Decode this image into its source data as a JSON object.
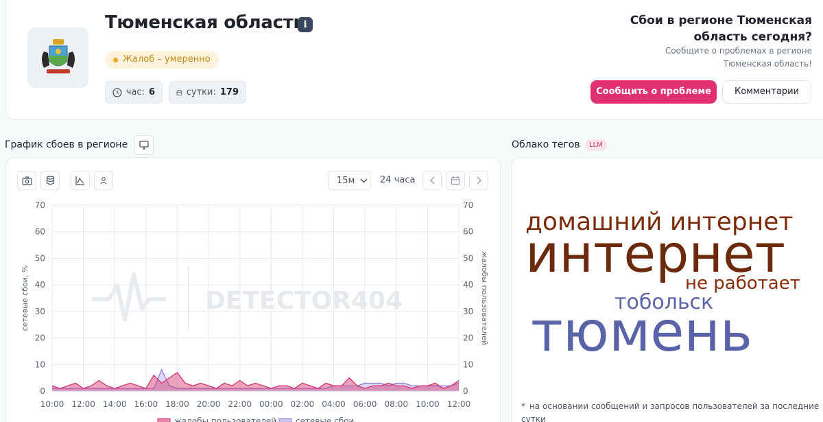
{
  "header": {
    "region_title": "Тюменская область",
    "status_badge": "Жалоб – умеренно",
    "stats": [
      {
        "label": "час:",
        "value": "6"
      },
      {
        "label": "сутки:",
        "value": "179"
      }
    ],
    "question_title": "Сбои в регионе Тюменская область сегодня?",
    "question_sub": "Сообщите о проблемах в регионе Тюменская область!",
    "report_button": "Сообщить о проблеме",
    "comments_button": "Комментарии"
  },
  "chart_section": {
    "title": "График сбоев в регионе",
    "interval_select": "15м",
    "period_label": "24 часа",
    "watermark": "DETECTOR404"
  },
  "cloud_section": {
    "title": "Облако тегов",
    "llm_badge": "LLM",
    "words": [
      {
        "text": "домашний интернет",
        "color": "#7b2b0a"
      },
      {
        "text": "интернет",
        "color": "#6b2a0c"
      },
      {
        "text": "не работает",
        "color": "#8a2e0e"
      },
      {
        "text": "тобольск",
        "color": "#5a63a8"
      },
      {
        "text": "тюмень",
        "color": "#5a63a8"
      }
    ],
    "footnote": "на основании сообщений и запросов пользователей за последние сутки"
  },
  "colors": {
    "accent": "#e0306f",
    "complaints": "#d6336f",
    "outages": "#8b7fd6",
    "badge_dot": "#f0a91f"
  },
  "chart_data": {
    "type": "area",
    "xlabel": "",
    "ylabel_left": "сетевые сбои, %",
    "ylabel_right": "жалобы пользователей",
    "ylim": [
      0,
      70
    ],
    "y_ticks": [
      "0",
      "10",
      "20",
      "30",
      "40",
      "50",
      "60",
      "70"
    ],
    "x_ticks": [
      "10:00",
      "12:00",
      "14:00",
      "16:00",
      "18:00",
      "20:00",
      "22:00",
      "00:00",
      "02:00",
      "04:00",
      "06:00",
      "08:00",
      "10:00",
      "12:00"
    ],
    "x": [
      "10:00",
      "10:30",
      "11:00",
      "11:30",
      "12:00",
      "12:30",
      "13:00",
      "13:30",
      "14:00",
      "14:30",
      "15:00",
      "15:30",
      "16:00",
      "16:30",
      "17:00",
      "17:30",
      "18:00",
      "18:30",
      "19:00",
      "19:30",
      "20:00",
      "20:30",
      "21:00",
      "21:30",
      "22:00",
      "22:30",
      "23:00",
      "23:30",
      "00:00",
      "00:30",
      "01:00",
      "01:30",
      "02:00",
      "02:30",
      "03:00",
      "03:30",
      "04:00",
      "04:30",
      "05:00",
      "05:30",
      "06:00",
      "06:30",
      "07:00",
      "07:30",
      "08:00",
      "08:30",
      "09:00",
      "09:30",
      "10:00",
      "10:30",
      "11:00",
      "11:30",
      "12:00"
    ],
    "series": [
      {
        "name": "жалобы пользователей",
        "values": [
          2,
          1,
          2,
          3,
          1,
          2,
          4,
          2,
          1,
          2,
          3,
          2,
          1,
          6,
          3,
          5,
          7,
          3,
          2,
          3,
          2,
          1,
          3,
          2,
          4,
          2,
          3,
          2,
          1,
          2,
          2,
          1,
          3,
          2,
          1,
          3,
          2,
          2,
          5,
          2,
          1,
          2,
          2,
          3,
          2,
          2,
          1,
          2,
          2,
          3,
          1,
          2,
          4
        ]
      },
      {
        "name": "сетевые сбои",
        "values": [
          1,
          1,
          1,
          1,
          1,
          1,
          1,
          1,
          1,
          1,
          1,
          1,
          1,
          1,
          8,
          2,
          1,
          1,
          1,
          1,
          1,
          1,
          1,
          1,
          1,
          1,
          1,
          1,
          1,
          1,
          1,
          1,
          1,
          1,
          1,
          1,
          2,
          2,
          2,
          2,
          3,
          3,
          3,
          2,
          3,
          3,
          2,
          2,
          2,
          2,
          2,
          2,
          3
        ]
      }
    ],
    "legend": "bottom",
    "grid": true
  }
}
